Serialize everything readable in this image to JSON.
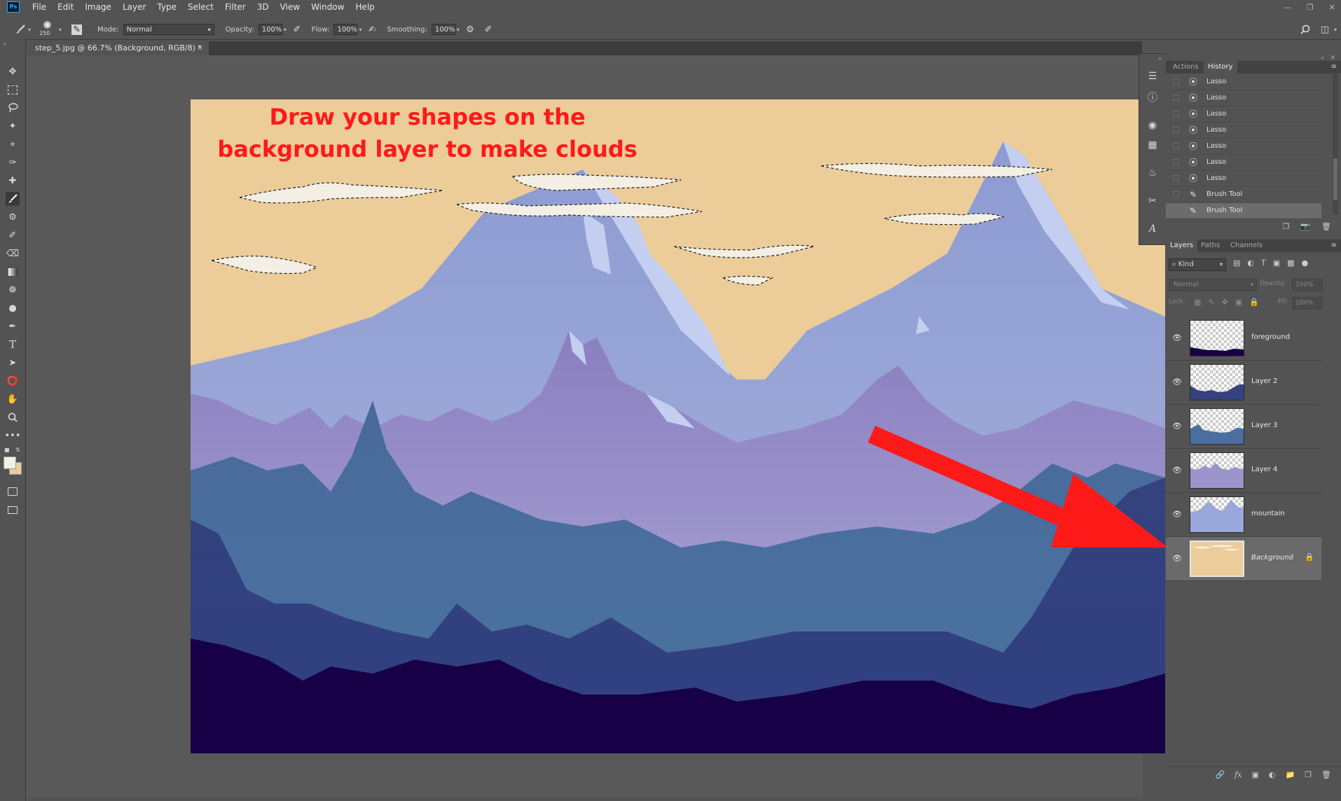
{
  "app": {
    "logo": "Ps"
  },
  "menu": [
    "File",
    "Edit",
    "Image",
    "Layer",
    "Type",
    "Select",
    "Filter",
    "3D",
    "View",
    "Window",
    "Help"
  ],
  "options_bar": {
    "brush_size": "250",
    "mode_label": "Mode:",
    "mode_value": "Normal",
    "opacity_label": "Opacity:",
    "opacity_value": "100%",
    "flow_label": "Flow:",
    "flow_value": "100%",
    "smoothing_label": "Smoothing:",
    "smoothing_value": "100%"
  },
  "document_tab": {
    "title": "step_5.jpg @ 66.7% (Background, RGB/8) *",
    "close": "×"
  },
  "annotation": {
    "line1": "Draw your shapes on the",
    "line2": "background layer to make clouds",
    "color": "#ff1a1a"
  },
  "colors": {
    "sky": "#eccc98",
    "foreground_swatch": "#f4efe4",
    "background_swatch": "#eccc98",
    "deep_purple": "#170046"
  },
  "history_panel": {
    "tabs": [
      "Actions",
      "History"
    ],
    "active_tab": "History",
    "items": [
      {
        "icon": "lasso-icon",
        "label": "Lasso"
      },
      {
        "icon": "lasso-icon",
        "label": "Lasso"
      },
      {
        "icon": "lasso-icon",
        "label": "Lasso"
      },
      {
        "icon": "lasso-icon",
        "label": "Lasso"
      },
      {
        "icon": "lasso-icon",
        "label": "Lasso"
      },
      {
        "icon": "lasso-icon",
        "label": "Lasso"
      },
      {
        "icon": "lasso-icon",
        "label": "Lasso"
      },
      {
        "icon": "brush-icon",
        "label": "Brush Tool"
      },
      {
        "icon": "brush-icon",
        "label": "Brush Tool",
        "selected": true
      }
    ]
  },
  "layers_panel": {
    "tabs": [
      "Layers",
      "Paths",
      "Channels"
    ],
    "active_tab": "Layers",
    "filter_label": "Kind",
    "blend_mode": "Normal",
    "opacity_label": "Opacity:",
    "opacity_value": "100%",
    "lock_label": "Lock:",
    "fill_label": "Fill:",
    "fill_value": "100%",
    "layers": [
      {
        "name": "foreground",
        "visible": true
      },
      {
        "name": "Layer 2",
        "visible": true
      },
      {
        "name": "Layer 3",
        "visible": true
      },
      {
        "name": "Layer 4",
        "visible": true
      },
      {
        "name": "mountain",
        "visible": true
      },
      {
        "name": "Background",
        "visible": true,
        "locked": true,
        "selected": true
      }
    ]
  }
}
